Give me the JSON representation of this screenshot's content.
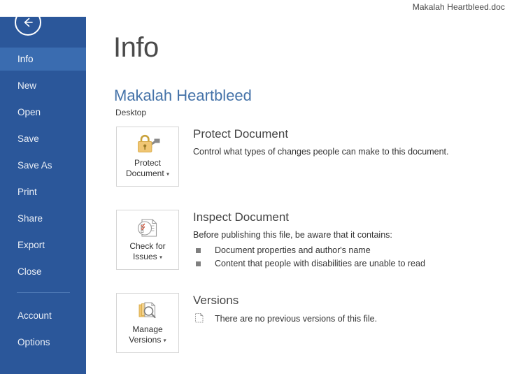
{
  "window": {
    "title": "Makalah Heartbleed.doc"
  },
  "sidebar": {
    "back_icon": "back-arrow-icon",
    "items": [
      {
        "label": "Info",
        "active": true
      },
      {
        "label": "New",
        "active": false
      },
      {
        "label": "Open",
        "active": false
      },
      {
        "label": "Save",
        "active": false
      },
      {
        "label": "Save As",
        "active": false
      },
      {
        "label": "Print",
        "active": false
      },
      {
        "label": "Share",
        "active": false
      },
      {
        "label": "Export",
        "active": false
      },
      {
        "label": "Close",
        "active": false
      }
    ],
    "footer_items": [
      {
        "label": "Account"
      },
      {
        "label": "Options"
      }
    ],
    "colors": {
      "background": "#2b579a",
      "active": "#3a6cb0",
      "text": "#ffffff"
    }
  },
  "main": {
    "page_title": "Info",
    "document_name": "Makalah Heartbleed",
    "document_path": "Desktop",
    "accent_color": "#4472a8",
    "sections": [
      {
        "button_label_line1": "Protect",
        "button_label_line2": "Document",
        "button_icon": "lock-and-key-icon",
        "title": "Protect Document",
        "description": "Control what types of changes people can make to this document.",
        "bullets": []
      },
      {
        "button_label_line1": "Check for",
        "button_label_line2": "Issues",
        "button_icon": "document-checklist-icon",
        "title": "Inspect Document",
        "description": "Before publishing this file, be aware that it contains:",
        "bullets": [
          "Document properties and author's name",
          "Content that people with disabilities are unable to read"
        ]
      },
      {
        "button_label_line1": "Manage",
        "button_label_line2": "Versions",
        "button_icon": "document-stack-search-icon",
        "title": "Versions",
        "description": "There are no previous versions of this file.",
        "bullets": []
      }
    ]
  }
}
